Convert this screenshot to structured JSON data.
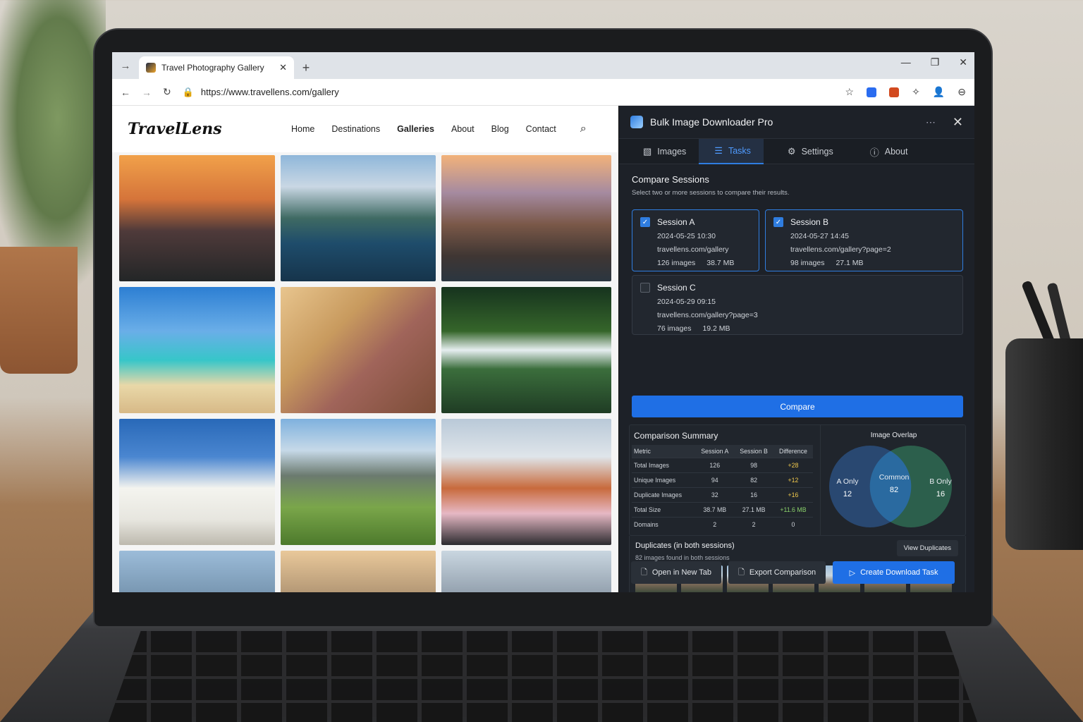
{
  "browser": {
    "tab_title": "Travel Photography Gallery",
    "tab_close": "✕",
    "new_tab": "+",
    "url": "https://www.travellens.com/gallery"
  },
  "site": {
    "logo": "TravelLens",
    "nav": [
      "Home",
      "Destinations",
      "Galleries",
      "About",
      "Blog",
      "Contact"
    ],
    "active_nav": "Galleries"
  },
  "extension": {
    "title": "Bulk Image Downloader Pro",
    "tabs": [
      {
        "label": "Images",
        "icon": "image-icon"
      },
      {
        "label": "Tasks",
        "icon": "list-icon"
      },
      {
        "label": "Settings",
        "icon": "gear-icon"
      },
      {
        "label": "About",
        "icon": "info-icon"
      }
    ],
    "active_tab": "Tasks",
    "compare": {
      "title": "Compare Sessions",
      "subtitle": "Select two or more sessions to compare their results.",
      "sessions": [
        {
          "name": "Session A",
          "date": "2024-05-25 10:30",
          "url": "travellens.com/gallery",
          "images": "126 images",
          "size": "38.7 MB",
          "checked": true
        },
        {
          "name": "Session B",
          "date": "2024-05-27 14:45",
          "url": "travellens.com/gallery?page=2",
          "images": "98 images",
          "size": "27.1 MB",
          "checked": true
        },
        {
          "name": "Session C",
          "date": "2024-05-29 09:15",
          "url": "travellens.com/gallery?page=3",
          "images": "76 images",
          "size": "19.2 MB",
          "checked": false
        }
      ],
      "button": "Compare"
    },
    "summary": {
      "title": "Comparison Summary",
      "headers": [
        "Metric",
        "Session A",
        "Session B",
        "Difference"
      ],
      "rows": [
        [
          "Total Images",
          "126",
          "98",
          "+28"
        ],
        [
          "Unique Images",
          "94",
          "82",
          "+12"
        ],
        [
          "Duplicate Images",
          "32",
          "16",
          "+16"
        ],
        [
          "Total Size",
          "38.7 MB",
          "27.1 MB",
          "+11.6 MB"
        ],
        [
          "Domains",
          "2",
          "2",
          "0"
        ]
      ]
    },
    "overlap": {
      "title": "Image Overlap",
      "a_only_label": "A Only",
      "a_only": "12",
      "common_label": "Common",
      "common": "82",
      "b_only_label": "B Only",
      "b_only": "16",
      "colors": {
        "a": "#2b4f7e",
        "common": "#2a6aa0",
        "b": "#2f6a52"
      }
    },
    "duplicates": {
      "title": "Duplicates (in both sessions)",
      "subtitle": "82 images found in both sessions",
      "view_button": "View Duplicates",
      "thumb_count": 7
    },
    "actions": {
      "open_tab": "Open in New Tab",
      "export": "Export Comparison",
      "create_task": "Create Download Task"
    }
  }
}
